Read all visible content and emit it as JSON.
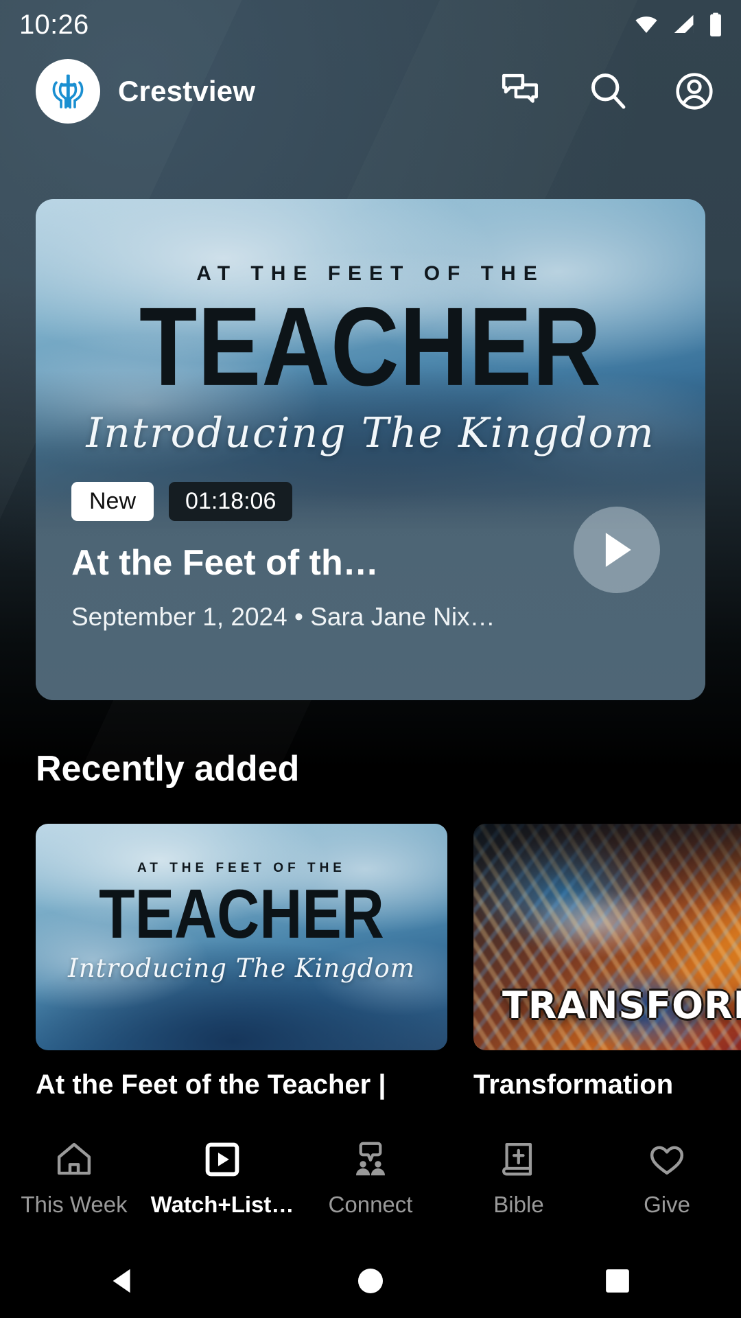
{
  "status_bar": {
    "time": "10:26",
    "icons": [
      "wifi-icon",
      "cellular-signal-icon",
      "battery-icon"
    ]
  },
  "header": {
    "brand_name": "Crestview",
    "logo_icon": "church-cross-logo",
    "actions": [
      {
        "name": "messages-icon",
        "label": "Messages"
      },
      {
        "name": "search-icon",
        "label": "Search"
      },
      {
        "name": "account-icon",
        "label": "Account"
      }
    ]
  },
  "featured": {
    "badge_new": "New",
    "duration": "01:18:06",
    "title": "At the Feet of th…",
    "meta": "September 1, 2024 • Sara Jane Nix…",
    "artwork": {
      "kicker": "AT THE FEET OF THE",
      "main": "TEACHER",
      "script": "Introducing The Kingdom"
    },
    "play_icon": "play-icon"
  },
  "section": {
    "heading": "Recently added"
  },
  "recently_added": [
    {
      "title": "At the Feet of the Teacher |",
      "artwork": {
        "kicker": "AT THE FEET OF THE",
        "main": "TEACHER",
        "script": "Introducing The Kingdom"
      }
    },
    {
      "title": "Transformation",
      "artwork": {
        "main": "TRANSFORMA"
      }
    }
  ],
  "bottom_nav": {
    "items": [
      {
        "label": "This Week",
        "icon": "home-icon",
        "active": false
      },
      {
        "label": "Watch+List…",
        "icon": "play-square-icon",
        "active": true
      },
      {
        "label": "Connect",
        "icon": "people-chat-icon",
        "active": false
      },
      {
        "label": "Bible",
        "icon": "bible-book-icon",
        "active": false
      },
      {
        "label": "Give",
        "icon": "heart-icon",
        "active": false
      }
    ]
  },
  "system_nav": {
    "back": "back-triangle-icon",
    "home": "home-circle-icon",
    "recents": "recents-square-icon"
  },
  "colors": {
    "header_bg": "#33444f",
    "page_bg": "#000000",
    "accent_blue": "#1a8fd1",
    "inactive_nav": "#9a9a9a",
    "active_nav": "#ffffff"
  }
}
